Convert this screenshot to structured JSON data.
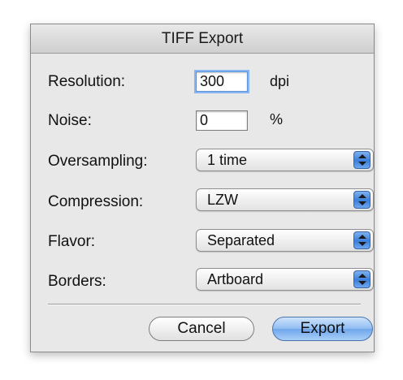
{
  "dialog": {
    "title": "TIFF Export"
  },
  "fields": {
    "resolution": {
      "label": "Resolution:",
      "value": "300",
      "unit": "dpi"
    },
    "noise": {
      "label": "Noise:",
      "value": "0",
      "unit": "%"
    }
  },
  "popups": {
    "oversampling": {
      "label": "Oversampling:",
      "value": "1 time"
    },
    "compression": {
      "label": "Compression:",
      "value": "LZW"
    },
    "flavor": {
      "label": "Flavor:",
      "value": "Separated"
    },
    "borders": {
      "label": "Borders:",
      "value": "Artboard"
    }
  },
  "buttons": {
    "cancel": "Cancel",
    "export": "Export"
  },
  "colors": {
    "accent": "#3b7fdb",
    "focus_ring": "#88b6f2"
  }
}
